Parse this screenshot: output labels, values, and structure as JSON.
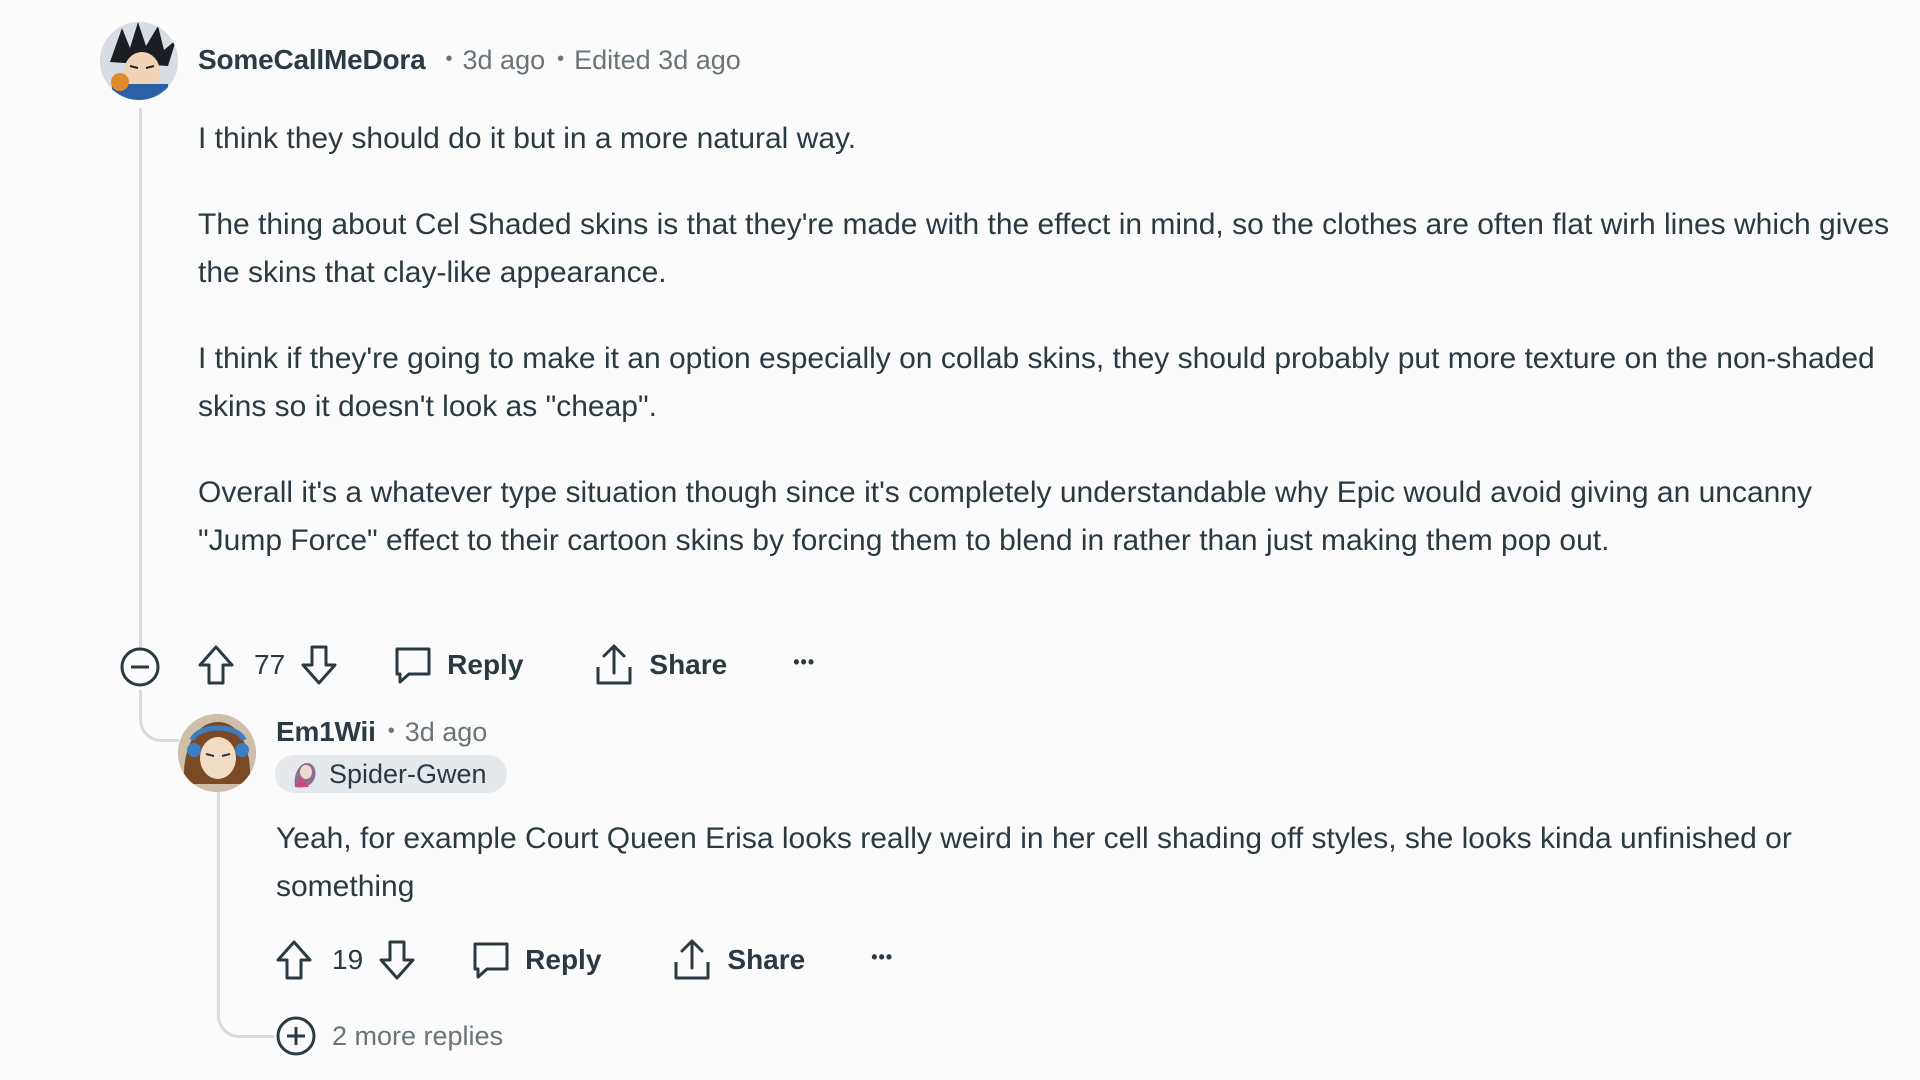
{
  "comment": {
    "username": "SomeCallMeDora",
    "time": "3d ago",
    "edited": "Edited 3d ago",
    "paragraphs": [
      "I think they should do it but in a more natural way.",
      "The thing about Cel Shaded skins is that they're made with the effect in mind, so the clothes are often flat wirh lines which gives the skins that clay-like appearance.",
      "I think if they're going to make it an option especially on collab skins, they should probably put more texture on the non-shaded skins so it doesn't look as \"cheap\".",
      "Overall it's a whatever type situation though since it's completely understandable why Epic would avoid giving an uncanny \"Jump Force\" effect to their cartoon skins by forcing them to blend in rather than just making them pop out."
    ],
    "votes": "77",
    "reply_label": "Reply",
    "share_label": "Share",
    "more_label": "•••"
  },
  "reply": {
    "username": "Em1Wii",
    "time": "3d ago",
    "flair": "Spider-Gwen",
    "text": "Yeah, for example Court Queen Erisa looks really weird in her cell shading off styles, she looks kinda unfinished or something",
    "votes": "19",
    "reply_label": "Reply",
    "share_label": "Share",
    "more_label": "•••"
  },
  "more_replies": "2 more replies",
  "icons": {
    "collapse": "minus-circle-icon",
    "expand": "plus-circle-icon",
    "upvote": "arrow-up-icon",
    "downvote": "arrow-down-icon",
    "reply": "speech-bubble-icon",
    "share": "share-icon",
    "more": "ellipsis-icon"
  },
  "colors": {
    "background": "#fbfbfb",
    "text": "#2a3a40",
    "meta": "#6a7479",
    "thread_line": "#d9dcdf",
    "flair_bg": "#e6e9ec"
  }
}
